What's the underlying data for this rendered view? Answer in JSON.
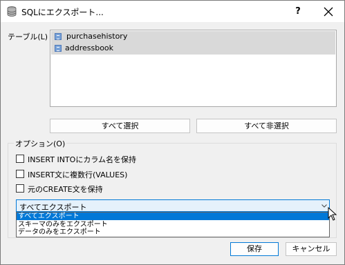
{
  "window": {
    "title": "SQLにエクスポート...",
    "help_label": "?"
  },
  "tables": {
    "label": "テーブル(L)",
    "items": [
      {
        "name": "purchasehistory"
      },
      {
        "name": "addressbook"
      }
    ]
  },
  "buttons": {
    "select_all": "すべて選択",
    "deselect_all": "すべて非選択",
    "save": "保存",
    "cancel": "キャンセル"
  },
  "options": {
    "label": "オプション(O)",
    "checkboxes": [
      {
        "label": "INSERT INTOにカラム名を保持",
        "checked": false
      },
      {
        "label": "INSERT文に複数行(VALUES)",
        "checked": false
      },
      {
        "label": "元のCREATE文を保持",
        "checked": false
      }
    ],
    "export_mode": {
      "selected": "すべてエクスポート",
      "options": [
        "すべてエクスポート",
        "スキーマのみをエクスポート",
        "データのみをエクスポート"
      ]
    }
  },
  "colors": {
    "accent": "#0078d7",
    "selection_bg": "#d9d9d9"
  }
}
